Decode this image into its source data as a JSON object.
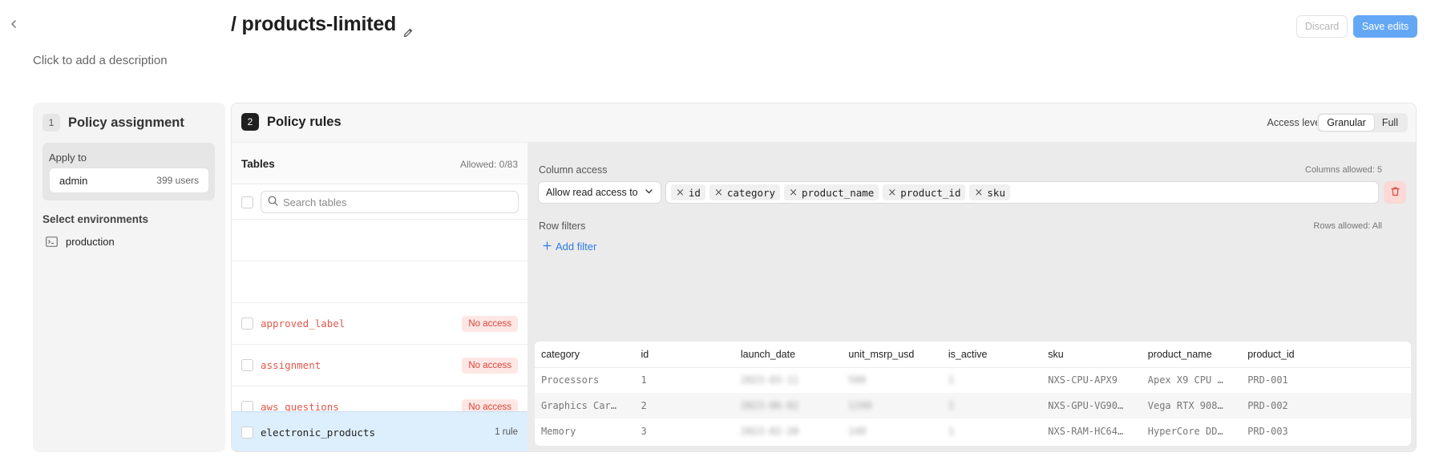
{
  "header": {
    "title": "/ products-limited",
    "description": "Click to add a description",
    "discard_label": "Discard",
    "save_label": "Save edits"
  },
  "assignment": {
    "step": "1",
    "title": "Policy assignment",
    "apply_to_label": "Apply to",
    "apply_item": {
      "name": "admin",
      "count": "399 users"
    },
    "environments_label": "Select environments",
    "environment": "production"
  },
  "rules": {
    "step": "2",
    "title": "Policy rules",
    "access_level_label": "Access level",
    "access_options": [
      "Granular",
      "Full"
    ],
    "access_selected": "Granular"
  },
  "tables": {
    "title": "Tables",
    "allowed": "Allowed: 0/83",
    "search_placeholder": "Search tables",
    "rows": [
      {
        "name": "approved_label",
        "status": "No access"
      },
      {
        "name": "assignment",
        "status": "No access"
      },
      {
        "name": "aws_questions",
        "status": "No access"
      }
    ],
    "selected": {
      "name": "electronic_products",
      "rules": "1 rule"
    }
  },
  "column_access": {
    "label": "Column access",
    "allowed_note": "Columns allowed: 5",
    "mode": "Allow read access to",
    "columns": [
      "id",
      "category",
      "product_name",
      "product_id",
      "sku"
    ]
  },
  "row_filters": {
    "label": "Row filters",
    "allowed_note": "Rows allowed: All",
    "add_label": "Add filter"
  },
  "preview": {
    "headers": [
      "category",
      "id",
      "launch_date",
      "unit_msrp_usd",
      "is_active",
      "sku",
      "product_name",
      "product_id"
    ],
    "rows": [
      [
        "Processors",
        "1",
        "2023-03-11",
        "599",
        "1",
        "NXS-CPU-APX9",
        "Apex X9 CPU …",
        "PRD-001"
      ],
      [
        "Graphics Car…",
        "2",
        "2023-06-02",
        "1199",
        "1",
        "NXS-GPU-VG90…",
        "Vega RTX 908…",
        "PRD-002"
      ],
      [
        "Memory",
        "3",
        "2023-02-20",
        "149",
        "1",
        "NXS-RAM-HC64…",
        "HyperCore DD…",
        "PRD-003"
      ]
    ]
  },
  "colors": {
    "primary": "#64a8f5",
    "danger": "#d9453a",
    "link": "#2d7be5",
    "selected_row": "#ddeefc"
  }
}
